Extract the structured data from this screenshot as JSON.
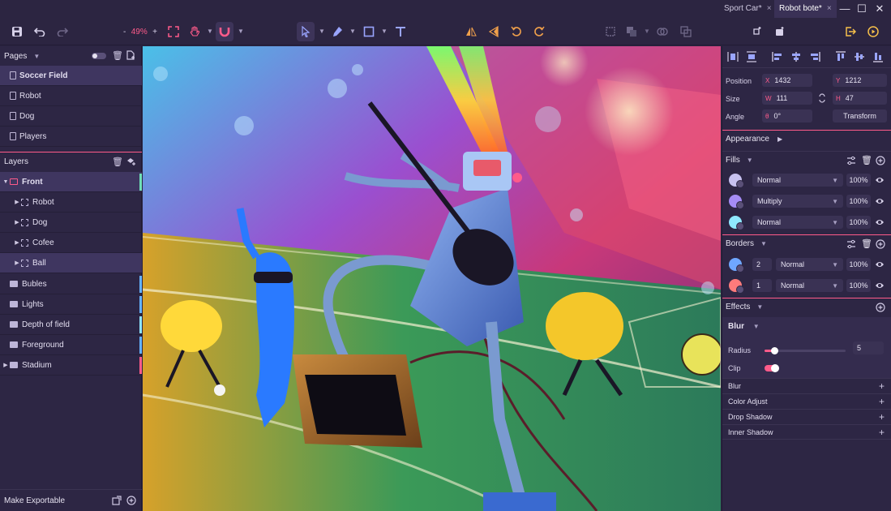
{
  "window": {
    "tabs": [
      {
        "label": "Sport Car*",
        "close": "×"
      },
      {
        "label": "Robot bote*",
        "close": "×"
      }
    ],
    "controls": {
      "minimize": "—",
      "maximize": "☐",
      "close": "✕"
    }
  },
  "toolbar": {
    "zoom_minus": "-",
    "zoom_value": "49%",
    "zoom_plus": "+"
  },
  "pages": {
    "title": "Pages",
    "items": [
      {
        "label": "Soccer Field",
        "selected": true
      },
      {
        "label": "Robot"
      },
      {
        "label": "Dog"
      },
      {
        "label": "Players"
      }
    ]
  },
  "layers": {
    "title": "Layers",
    "items": [
      {
        "label": "Front",
        "type": "group-red",
        "expanded": true,
        "color": "#6fe0b8"
      },
      {
        "label": "Robot",
        "type": "frame",
        "child": true
      },
      {
        "label": "Dog",
        "type": "frame",
        "child": true
      },
      {
        "label": "Cofee",
        "type": "frame",
        "child": true
      },
      {
        "label": "Ball",
        "type": "frame",
        "child": true,
        "selected": true
      },
      {
        "label": "Bubles",
        "type": "folder",
        "color": "#66b3ff"
      },
      {
        "label": "Lights",
        "type": "folder",
        "color": "#66b3ff"
      },
      {
        "label": "Depth of field",
        "type": "folder",
        "color": "#8fe4ff"
      },
      {
        "label": "Foreground",
        "type": "folder",
        "color": "#66b3ff"
      },
      {
        "label": "Stadium",
        "type": "folder",
        "collapsed": true,
        "color": "#ff5b8a"
      }
    ]
  },
  "export": {
    "label": "Make Exportable"
  },
  "inspector": {
    "position": {
      "label": "Position",
      "x_key": "X",
      "x": "1432",
      "y_key": "Y",
      "y": "1212"
    },
    "size": {
      "label": "Size",
      "w_key": "W",
      "w": "111",
      "h_key": "H",
      "h": "47"
    },
    "angle": {
      "label": "Angle",
      "key": "θ",
      "value": "0°",
      "transform": "Transform"
    },
    "appearance": {
      "label": "Appearance"
    },
    "fills": {
      "title": "Fills",
      "items": [
        {
          "blend": "Normal",
          "opacity": "100%",
          "color": "#c7c1f0"
        },
        {
          "blend": "Multiply",
          "opacity": "100%",
          "color": "#a58cf5"
        },
        {
          "blend": "Normal",
          "opacity": "100%",
          "color": "#8fe8ff"
        }
      ]
    },
    "borders": {
      "title": "Borders",
      "items": [
        {
          "width": "2",
          "blend": "Normal",
          "opacity": "100%",
          "color": "#6fa7ff"
        },
        {
          "width": "1",
          "blend": "Normal",
          "opacity": "100%",
          "color": "#ff7b7b"
        }
      ]
    },
    "effects": {
      "title": "Effects",
      "active": {
        "label": "Blur",
        "radius_label": "Radius",
        "radius": "5",
        "radius_fraction": 0.12,
        "clip_label": "Clip"
      },
      "list": [
        "Blur",
        "Color Adjust",
        "Drop Shadow",
        "Inner Shadow"
      ]
    }
  },
  "icons": {
    "save": "floppy-icon",
    "undo": "undo-icon",
    "redo": "redo-icon",
    "fit": "fit-screen-icon",
    "hand": "hand-icon",
    "magnet": "magnet-icon",
    "pointer": "pointer-icon",
    "pen": "pen-icon",
    "rectangle": "rectangle-icon",
    "text": "text-icon",
    "flip_h": "flip-horizontal-icon",
    "flip_v": "flip-vertical-icon",
    "rotate_left": "rotate-left-icon",
    "rotate_right": "rotate-right-icon",
    "export": "export-icon",
    "play": "play-icon"
  },
  "colors": {
    "accent": "#ff5b8a",
    "panel": "#2d2644",
    "selected": "#3f3660"
  }
}
